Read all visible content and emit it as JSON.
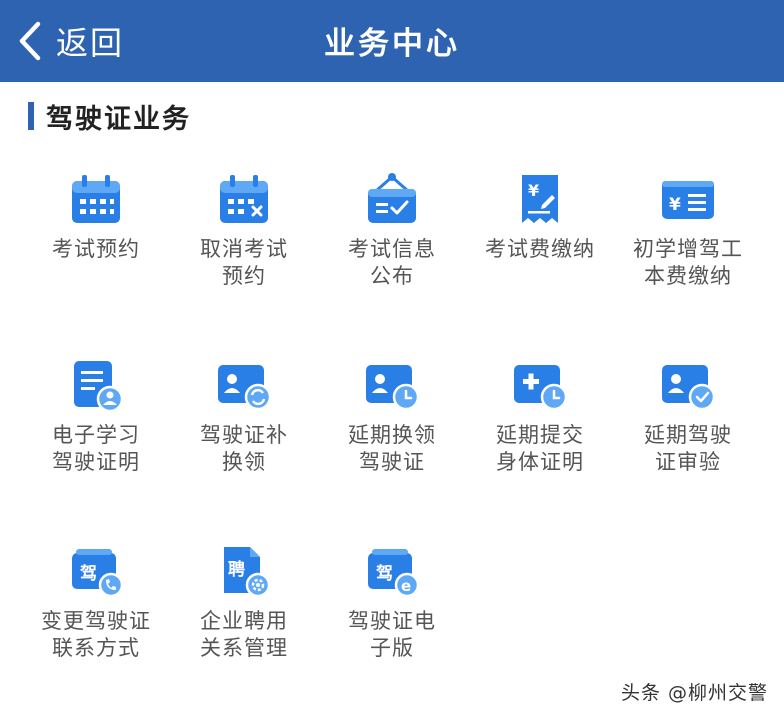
{
  "header": {
    "back_label": "返回",
    "title": "业务中心",
    "background": "#2d63b1"
  },
  "section": {
    "title": "驾驶证业务"
  },
  "tiles": [
    {
      "icon": "calendar-icon",
      "lines": [
        "考试预约",
        ""
      ]
    },
    {
      "icon": "calendar-cancel-icon",
      "lines": [
        "取消考试",
        "预约"
      ]
    },
    {
      "icon": "notice-board-icon",
      "lines": [
        "考试信息",
        "公布"
      ]
    },
    {
      "icon": "receipt-yen-icon",
      "lines": [
        "考试费缴纳",
        ""
      ]
    },
    {
      "icon": "yen-card-icon",
      "lines": [
        "初学增驾工",
        "本费缴纳"
      ]
    },
    {
      "icon": "document-user-icon",
      "lines": [
        "电子学习",
        "驾驶证明"
      ]
    },
    {
      "icon": "id-card-refresh-icon",
      "lines": [
        "驾驶证补",
        "换领"
      ]
    },
    {
      "icon": "id-card-clock-icon",
      "lines": [
        "延期换领",
        "驾驶证"
      ]
    },
    {
      "icon": "medical-clock-icon",
      "lines": [
        "延期提交",
        "身体证明"
      ]
    },
    {
      "icon": "id-card-check-icon",
      "lines": [
        "延期驾驶",
        "证审验"
      ]
    },
    {
      "icon": "license-phone-icon",
      "lines": [
        "变更驾驶证",
        "联系方式"
      ],
      "glyph": "驾"
    },
    {
      "icon": "hire-document-gear-icon",
      "lines": [
        "企业聘用",
        "关系管理"
      ],
      "glyph": "聘"
    },
    {
      "icon": "license-e-icon",
      "lines": [
        "驾驶证电",
        "子版"
      ],
      "glyph": "驾"
    }
  ],
  "watermark": "头条 @柳州交警",
  "colors": {
    "accent": "#2d63b1",
    "icon_blue": "#2a7fe6",
    "icon_light": "#5fa8f5"
  }
}
